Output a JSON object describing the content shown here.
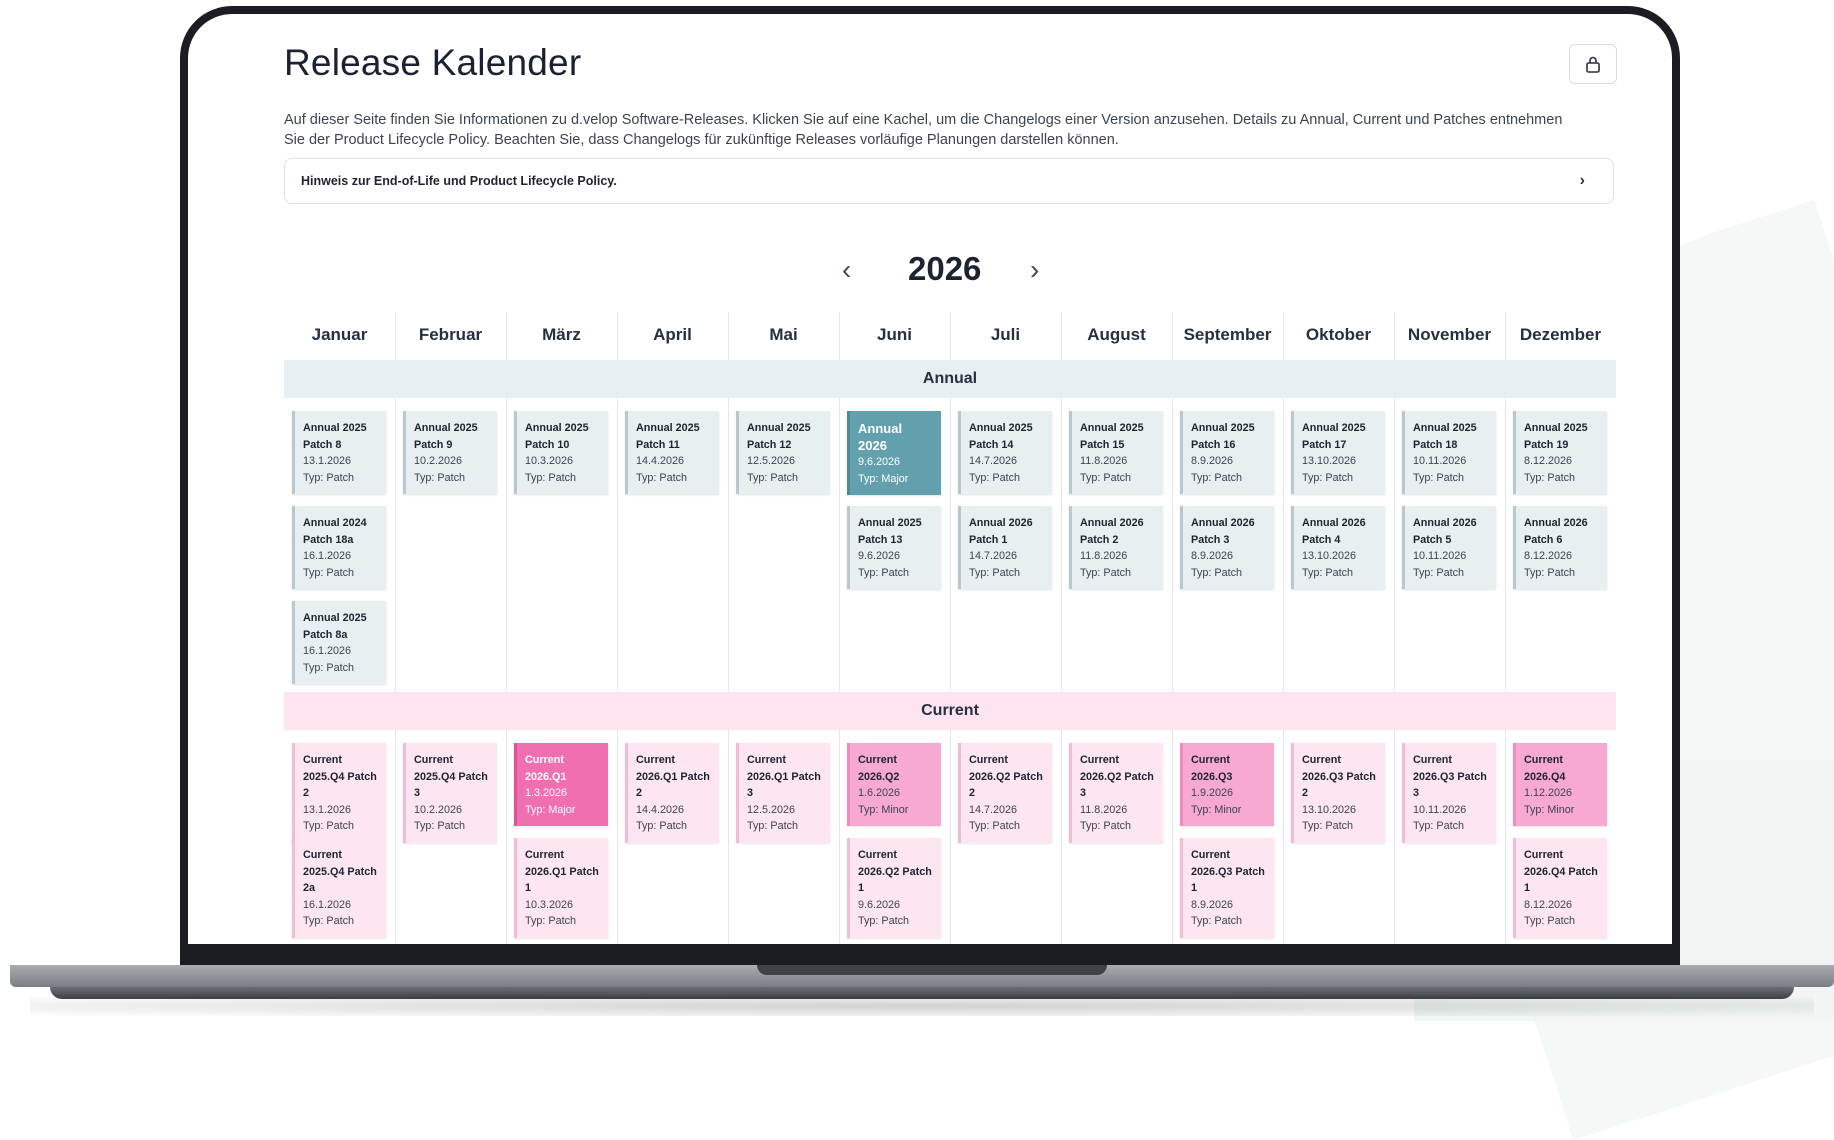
{
  "page": {
    "title": "Release Kalender",
    "intro": "Auf dieser Seite finden Sie Informationen zu d.velop Software-Releases. Klicken Sie auf eine Kachel, um die Changelogs einer Version anzusehen. Details zu Annual, Current und Patches entnehmen Sie der Product Lifecycle Policy. Beachten Sie, dass Changelogs für zukünftige Releases vorläufige Planungen darstellen können.",
    "hint": "Hinweis zur End-of-Life und Product Lifecycle Policy.",
    "hint_chevron": "›",
    "lock_icon": "lock-icon"
  },
  "calendar": {
    "year": "2026",
    "prev": "‹",
    "next": "›",
    "months": [
      "Januar",
      "Februar",
      "März",
      "April",
      "Mai",
      "Juni",
      "Juli",
      "August",
      "September",
      "Oktober",
      "November",
      "Dezember"
    ],
    "bands": {
      "annual": "Annual",
      "current": "Current"
    },
    "annual": [
      [
        {
          "name": "Annual 2025 Patch 8",
          "date": "13.1.2026",
          "type": "Typ: Patch"
        },
        {
          "name": "Annual 2024 Patch 18a",
          "date": "16.1.2026",
          "type": "Typ: Patch"
        },
        {
          "name": "Annual 2025 Patch 8a",
          "date": "16.1.2026",
          "type": "Typ: Patch"
        }
      ],
      [
        {
          "name": "Annual 2025 Patch 9",
          "date": "10.2.2026",
          "type": "Typ: Patch"
        }
      ],
      [
        {
          "name": "Annual 2025 Patch 10",
          "date": "10.3.2026",
          "type": "Typ: Patch"
        }
      ],
      [
        {
          "name": "Annual 2025 Patch 11",
          "date": "14.4.2026",
          "type": "Typ: Patch"
        }
      ],
      [
        {
          "name": "Annual 2025 Patch 12",
          "date": "12.5.2026",
          "type": "Typ: Patch"
        }
      ],
      [
        {
          "name": "Annual 2026",
          "date": "9.6.2026",
          "type": "Typ: Major",
          "variant": "major"
        },
        {
          "name": "Annual 2025 Patch 13",
          "date": "9.6.2026",
          "type": "Typ: Patch"
        }
      ],
      [
        {
          "name": "Annual 2025 Patch 14",
          "date": "14.7.2026",
          "type": "Typ: Patch"
        },
        {
          "name": "Annual 2026 Patch 1",
          "date": "14.7.2026",
          "type": "Typ: Patch"
        }
      ],
      [
        {
          "name": "Annual 2025 Patch 15",
          "date": "11.8.2026",
          "type": "Typ: Patch"
        },
        {
          "name": "Annual 2026 Patch 2",
          "date": "11.8.2026",
          "type": "Typ: Patch"
        }
      ],
      [
        {
          "name": "Annual 2025 Patch 16",
          "date": "8.9.2026",
          "type": "Typ: Patch"
        },
        {
          "name": "Annual 2026 Patch 3",
          "date": "8.9.2026",
          "type": "Typ: Patch"
        }
      ],
      [
        {
          "name": "Annual 2025 Patch 17",
          "date": "13.10.2026",
          "type": "Typ: Patch"
        },
        {
          "name": "Annual 2026 Patch 4",
          "date": "13.10.2026",
          "type": "Typ: Patch"
        }
      ],
      [
        {
          "name": "Annual 2025 Patch 18",
          "date": "10.11.2026",
          "type": "Typ: Patch"
        },
        {
          "name": "Annual 2026 Patch 5",
          "date": "10.11.2026",
          "type": "Typ: Patch"
        }
      ],
      [
        {
          "name": "Annual 2025 Patch 19",
          "date": "8.12.2026",
          "type": "Typ: Patch"
        },
        {
          "name": "Annual 2026 Patch 6",
          "date": "8.12.2026",
          "type": "Typ: Patch"
        }
      ]
    ],
    "current": [
      [
        {
          "name": "Current 2025.Q4 Patch 2",
          "date": "13.1.2026",
          "type": "Typ: Patch"
        },
        {
          "name": "Current 2025.Q4 Patch 2a",
          "date": "16.1.2026",
          "type": "Typ: Patch"
        }
      ],
      [
        {
          "name": "Current 2025.Q4 Patch 3",
          "date": "10.2.2026",
          "type": "Typ: Patch"
        }
      ],
      [
        {
          "name": "Current 2026.Q1",
          "date": "1.3.2026",
          "type": "Typ: Major",
          "variant": "major"
        },
        {
          "name": "Current 2026.Q1 Patch 1",
          "date": "10.3.2026",
          "type": "Typ: Patch"
        }
      ],
      [
        {
          "name": "Current 2026.Q1 Patch 2",
          "date": "14.4.2026",
          "type": "Typ: Patch"
        }
      ],
      [
        {
          "name": "Current 2026.Q1 Patch 3",
          "date": "12.5.2026",
          "type": "Typ: Patch"
        }
      ],
      [
        {
          "name": "Current 2026.Q2",
          "date": "1.6.2026",
          "type": "Typ: Minor",
          "variant": "minor"
        },
        {
          "name": "Current 2026.Q2 Patch 1",
          "date": "9.6.2026",
          "type": "Typ: Patch"
        }
      ],
      [
        {
          "name": "Current 2026.Q2 Patch 2",
          "date": "14.7.2026",
          "type": "Typ: Patch"
        }
      ],
      [
        {
          "name": "Current 2026.Q2 Patch 3",
          "date": "11.8.2026",
          "type": "Typ: Patch"
        }
      ],
      [
        {
          "name": "Current 2026.Q3",
          "date": "1.9.2026",
          "type": "Typ: Minor",
          "variant": "minor"
        },
        {
          "name": "Current 2026.Q3 Patch 1",
          "date": "8.9.2026",
          "type": "Typ: Patch"
        }
      ],
      [
        {
          "name": "Current 2026.Q3 Patch 2",
          "date": "13.10.2026",
          "type": "Typ: Patch"
        }
      ],
      [
        {
          "name": "Current 2026.Q3 Patch 3",
          "date": "10.11.2026",
          "type": "Typ: Patch"
        }
      ],
      [
        {
          "name": "Current 2026.Q4",
          "date": "1.12.2026",
          "type": "Typ: Minor",
          "variant": "minor"
        },
        {
          "name": "Current 2026.Q4 Patch 1",
          "date": "8.12.2026",
          "type": "Typ: Patch"
        }
      ]
    ]
  },
  "colors": {
    "annual_band": "#e6eff1",
    "current_band": "#fde4f0",
    "annual_major": "#63a0ad",
    "current_major": "#ef6fb1",
    "current_minor": "#f7a9d1"
  }
}
